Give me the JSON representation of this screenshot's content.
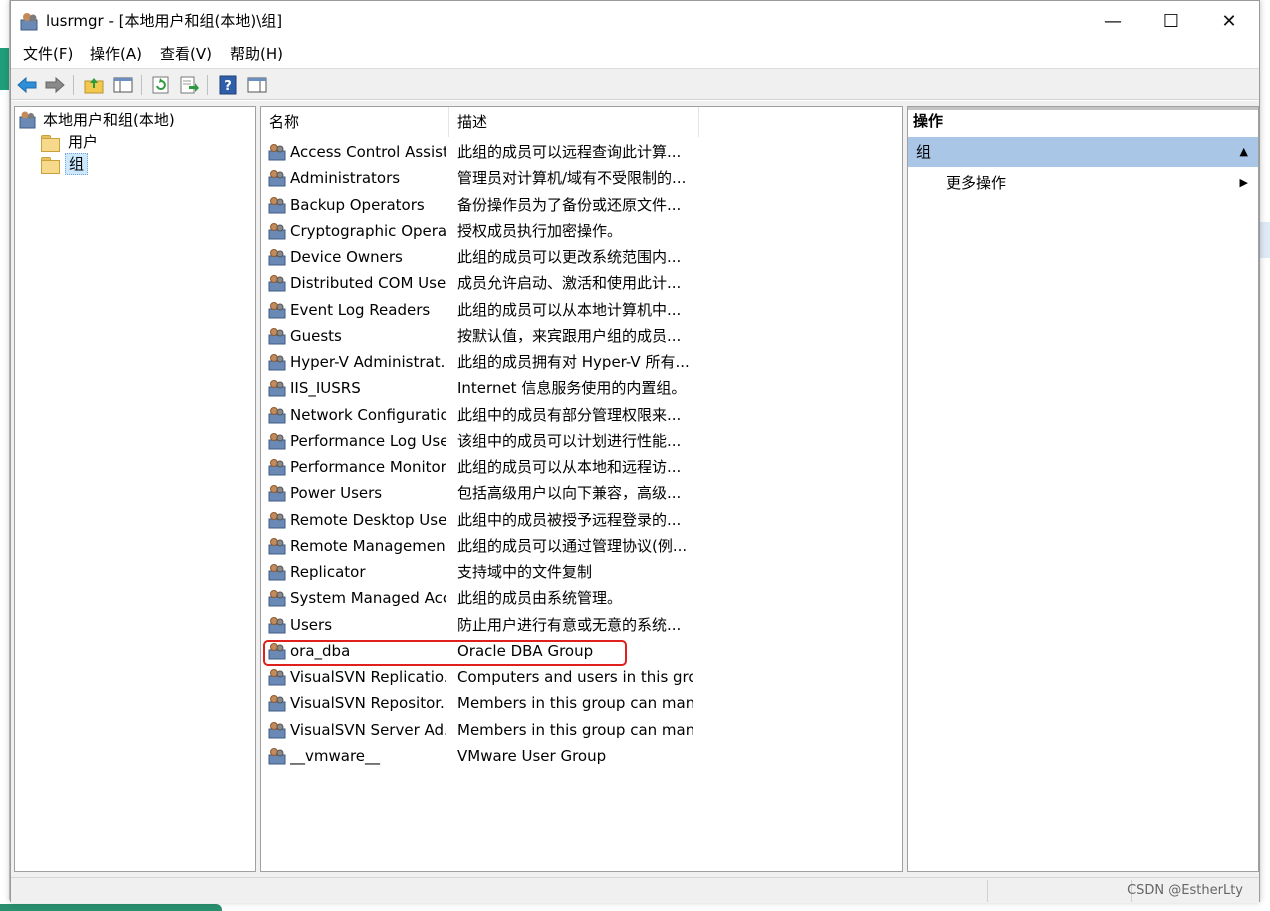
{
  "window": {
    "title": "lusrmgr - [本地用户和组(本地)\\组]",
    "min_glyph": "—",
    "max_glyph": "☐",
    "close_glyph": "✕"
  },
  "menu": [
    "文件(F)",
    "操作(A)",
    "查看(V)",
    "帮助(H)"
  ],
  "toolbar_icons": [
    "back-arrow-icon",
    "forward-arrow-icon",
    "up-folder-icon",
    "show-hide-tree-icon",
    "refresh-icon",
    "export-list-icon",
    "help-icon",
    "show-hide-action-pane-icon"
  ],
  "tree": {
    "root": "本地用户和组(本地)",
    "children": [
      "用户",
      "组"
    ],
    "selected": "组"
  },
  "list": {
    "columns": [
      "名称",
      "描述"
    ],
    "rows": [
      {
        "name": "Access Control Assist...",
        "desc": "此组的成员可以远程查询此计算..."
      },
      {
        "name": "Administrators",
        "desc": "管理员对计算机/域有不受限制的..."
      },
      {
        "name": "Backup Operators",
        "desc": "备份操作员为了备份或还原文件..."
      },
      {
        "name": "Cryptographic Operat...",
        "desc": "授权成员执行加密操作。"
      },
      {
        "name": "Device Owners",
        "desc": "此组的成员可以更改系统范围内..."
      },
      {
        "name": "Distributed COM Users",
        "desc": "成员允许启动、激活和使用此计..."
      },
      {
        "name": "Event Log Readers",
        "desc": "此组的成员可以从本地计算机中..."
      },
      {
        "name": "Guests",
        "desc": "按默认值，来宾跟用户组的成员..."
      },
      {
        "name": "Hyper-V Administrat...",
        "desc": "此组的成员拥有对 Hyper-V 所有..."
      },
      {
        "name": "IIS_IUSRS",
        "desc": "Internet 信息服务使用的内置组。"
      },
      {
        "name": "Network Configuratio...",
        "desc": "此组中的成员有部分管理权限来..."
      },
      {
        "name": "Performance Log Users",
        "desc": "该组中的成员可以计划进行性能..."
      },
      {
        "name": "Performance Monitor...",
        "desc": "此组的成员可以从本地和远程访..."
      },
      {
        "name": "Power Users",
        "desc": "包括高级用户以向下兼容，高级..."
      },
      {
        "name": "Remote Desktop Users",
        "desc": "此组中的成员被授予远程登录的..."
      },
      {
        "name": "Remote Managemen...",
        "desc": "此组的成员可以通过管理协议(例..."
      },
      {
        "name": "Replicator",
        "desc": "支持域中的文件复制"
      },
      {
        "name": "System Managed Acc...",
        "desc": "此组的成员由系统管理。"
      },
      {
        "name": "Users",
        "desc": "防止用户进行有意或无意的系统..."
      },
      {
        "name": "ora_dba",
        "desc": "Oracle DBA Group"
      },
      {
        "name": "VisualSVN Replicatio...",
        "desc": "Computers and users in this grou..."
      },
      {
        "name": "VisualSVN Repositor...",
        "desc": "Members in this group can mana..."
      },
      {
        "name": "VisualSVN Server Ad...",
        "desc": "Members in this group can mana..."
      },
      {
        "name": "__vmware__",
        "desc": "VMware User Group"
      }
    ],
    "highlighted_row": "ora_dba",
    "highlight_color": "#e0201c"
  },
  "actions": {
    "header": "操作",
    "section": "组",
    "more": "更多操作"
  },
  "status": {
    "watermark": "CSDN @EstherLty"
  },
  "colors": {
    "selection": "#cce8ff",
    "action_section": "#a9c6e7"
  }
}
